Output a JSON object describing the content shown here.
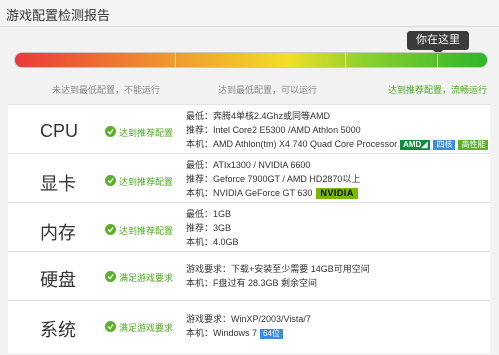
{
  "window": {
    "title": "游戏配置检测报告"
  },
  "meter": {
    "tooltip": "你在这里",
    "labels": [
      "未达到最低配置，不能运行",
      "达到最低配置，可以运行",
      "达到推荐配置，流畅运行"
    ],
    "level": 0.9
  },
  "rows": [
    {
      "name": "CPU",
      "status": "达到推荐配置",
      "lines": [
        "最低：奔腾4单核2.4Ghz或同等AMD",
        "推荐：Intel Core2 E5300 /AMD Athlon 5000",
        "本机：AMD Athlon(tm) X4 740 Quad Core Processor"
      ],
      "badges": [
        "AMD",
        "四核",
        "高性能"
      ]
    },
    {
      "name": "显卡",
      "status": "达到推荐配置",
      "lines": [
        "最低：ATIx1300 / NVIDIA 6600",
        "推荐：Geforce 7900GT / AMD HD2870以上",
        "本机：NVIDIA GeForce GT 630"
      ],
      "badges": [
        "NVIDIA"
      ]
    },
    {
      "name": "内存",
      "status": "达到推荐配置",
      "lines": [
        "最低：1GB",
        "推荐：3GB",
        "本机：4.0GB"
      ]
    },
    {
      "name": "硬盘",
      "status": "满足游戏要求",
      "lines": [
        "游戏要求：下载+安装至少需要 14GB可用空间",
        "本机：F盘过有 28.3GB 剩余空间"
      ]
    },
    {
      "name": "系统",
      "status": "满足游戏要求",
      "lines": [
        "游戏要求：WinXP/2003/Vista/7",
        "本机：Windows 7"
      ],
      "badges": [
        "64位"
      ]
    }
  ],
  "colors": {
    "ok_green": "#4ea91f",
    "bar_red": "#ea3a3a",
    "bar_green": "#2fb52a"
  }
}
